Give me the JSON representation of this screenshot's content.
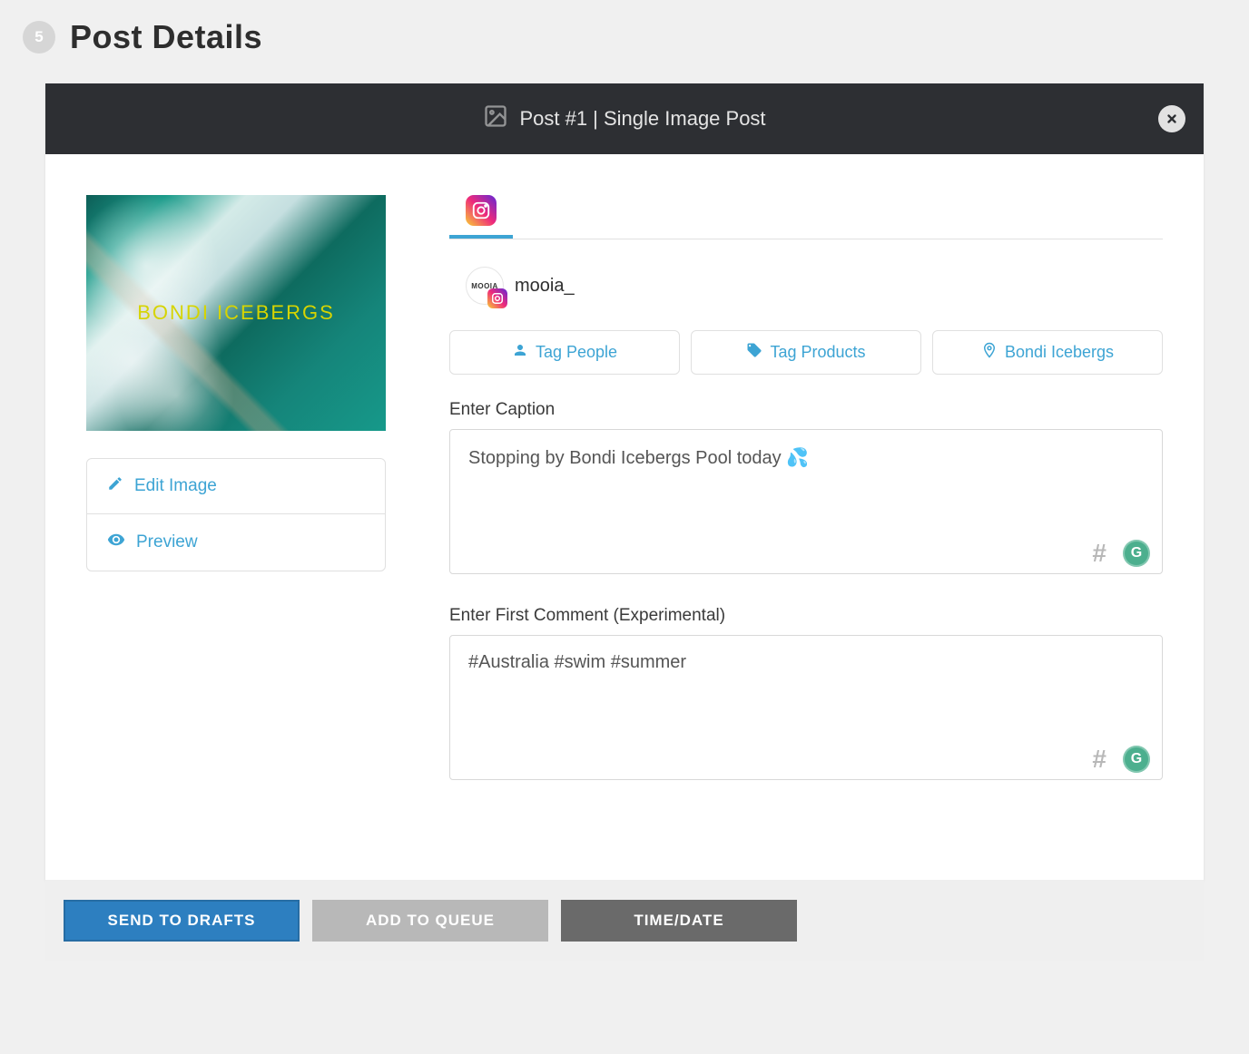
{
  "step": "5",
  "page_title": "Post Details",
  "header": {
    "title": "Post #1 | Single Image Post"
  },
  "thumbnail": {
    "overlay_text": "BONDI ICEBERGS"
  },
  "side_actions": {
    "edit": "Edit Image",
    "preview": "Preview"
  },
  "account": {
    "avatar_text": "MOOIA",
    "name": "mooia_"
  },
  "tag_buttons": {
    "people": "Tag People",
    "products": "Tag Products",
    "location": "Bondi Icebergs"
  },
  "caption": {
    "label": "Enter Caption",
    "value": "Stopping by Bondi Icebergs Pool today 💦"
  },
  "first_comment": {
    "label": "Enter First Comment (Experimental)",
    "value": "#Australia #swim #summer"
  },
  "footer": {
    "drafts": "SEND TO DRAFTS",
    "queue": "ADD TO QUEUE",
    "time": "TIME/DATE"
  }
}
